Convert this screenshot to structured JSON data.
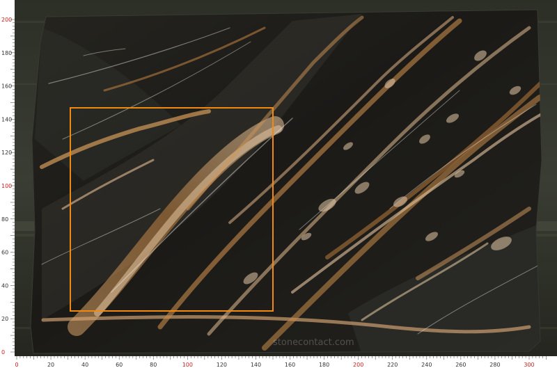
{
  "scene": {
    "description_colors": {
      "background": "#2a2d24",
      "stone": "#1e1e1b",
      "vein_gold": "#c98c4a",
      "vein_light": "#e8c9a8",
      "frame": "#f08a10",
      "ruler_text": "#333333",
      "ruler_highlight": "#d21b1b"
    }
  },
  "ruler": {
    "x_ticks": [
      {
        "label": "0",
        "highlight": true
      },
      {
        "label": "20",
        "highlight": false
      },
      {
        "label": "40",
        "highlight": false
      },
      {
        "label": "60",
        "highlight": false
      },
      {
        "label": "80",
        "highlight": false
      },
      {
        "label": "100",
        "highlight": true
      },
      {
        "label": "120",
        "highlight": false
      },
      {
        "label": "140",
        "highlight": false
      },
      {
        "label": "160",
        "highlight": false
      },
      {
        "label": "180",
        "highlight": false
      },
      {
        "label": "200",
        "highlight": true
      },
      {
        "label": "220",
        "highlight": false
      },
      {
        "label": "240",
        "highlight": false
      },
      {
        "label": "260",
        "highlight": false
      },
      {
        "label": "280",
        "highlight": false
      },
      {
        "label": "300",
        "highlight": true
      }
    ],
    "y_ticks": [
      {
        "label": "0",
        "highlight": true
      },
      {
        "label": "20",
        "highlight": false
      },
      {
        "label": "40",
        "highlight": false
      },
      {
        "label": "60",
        "highlight": false
      },
      {
        "label": "80",
        "highlight": false
      },
      {
        "label": "100",
        "highlight": true
      },
      {
        "label": "120",
        "highlight": false
      },
      {
        "label": "140",
        "highlight": false
      },
      {
        "label": "160",
        "highlight": false
      },
      {
        "label": "180",
        "highlight": false
      },
      {
        "label": "200",
        "highlight": true
      }
    ]
  },
  "watermark": {
    "text": "stonecontact.com"
  }
}
